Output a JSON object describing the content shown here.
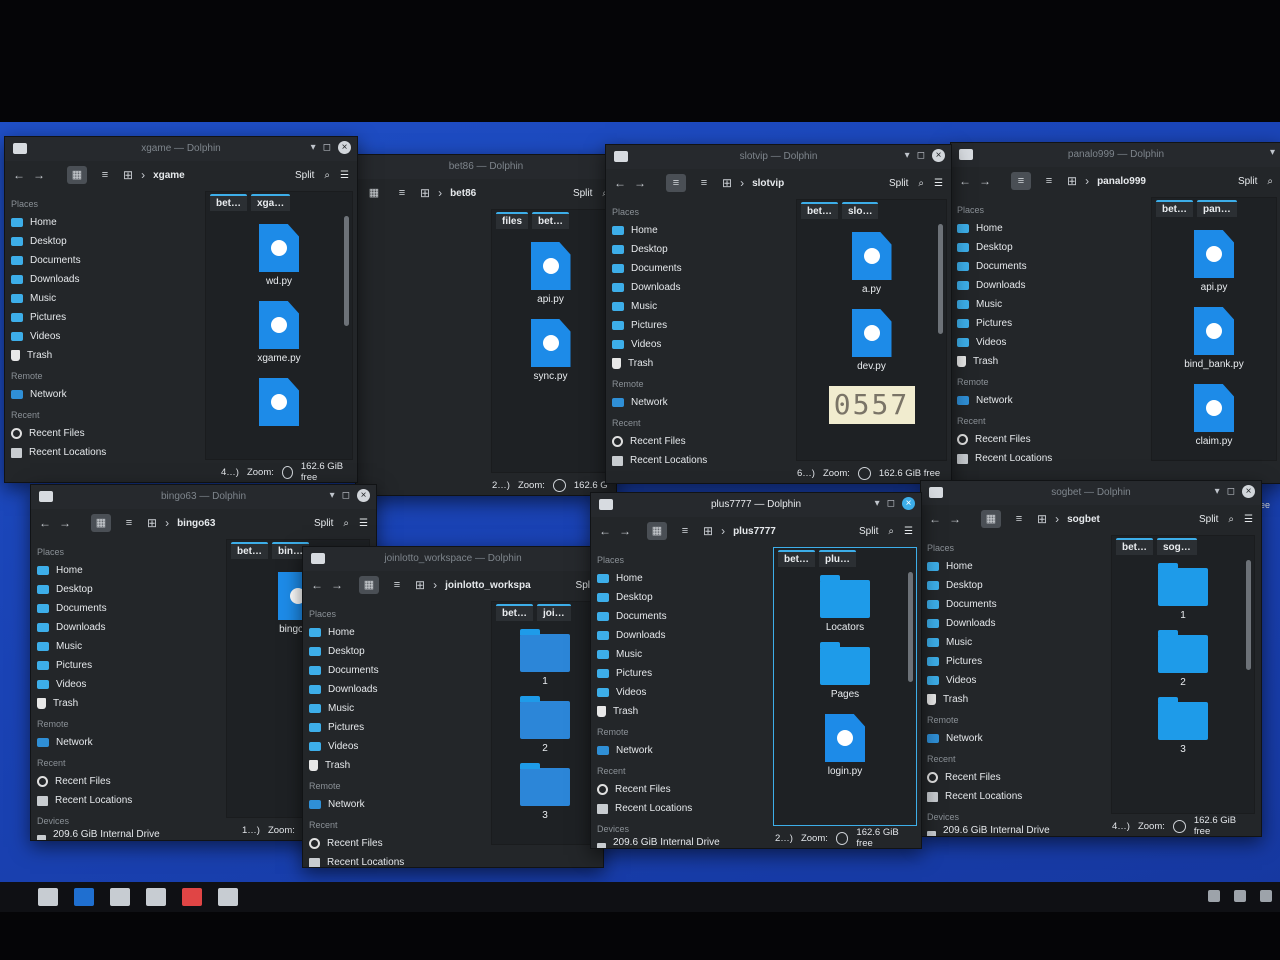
{
  "places": {
    "section_places": "Places",
    "home": "Home",
    "desktop": "Desktop",
    "documents": "Documents",
    "downloads": "Downloads",
    "music": "Music",
    "pictures": "Pictures",
    "videos": "Videos",
    "trash": "Trash",
    "section_remote": "Remote",
    "network": "Network",
    "section_recent": "Recent",
    "recent_files": "Recent Files",
    "recent_locations": "Recent Locations",
    "section_devices": "Devices",
    "drive": "209.6 GiB Internal Drive (nvme0n1…"
  },
  "common": {
    "split": "Split",
    "zoom": "Zoom:",
    "free": "162.6 GiB free"
  },
  "windows": {
    "w1": {
      "title": "xgame — Dolphin",
      "crumb": "xgame",
      "tab1": "bet…",
      "tab2": "xga…",
      "status_count": "4…)",
      "files": [
        "wd.py",
        "xgame.py"
      ]
    },
    "w2": {
      "title": "bet86 — Dolphin",
      "crumb": "bet86",
      "tab1": "files",
      "tab2": "bet…",
      "status_count": "2…)",
      "free_partial": "162.6 G",
      "files": [
        "api.py",
        "sync.py"
      ]
    },
    "w3": {
      "title": "slotvip — Dolphin",
      "crumb": "slotvip",
      "tab1": "bet…",
      "tab2": "slo…",
      "status_count": "6…)",
      "files": [
        "a.py",
        "dev.py"
      ],
      "captcha": "0557"
    },
    "w4": {
      "title": "panalo999 — Dolphin",
      "crumb": "panalo999",
      "tab1": "bet…",
      "tab2": "pan…",
      "files": [
        "api.py",
        "bind_bank.py",
        "claim.py"
      ]
    },
    "w5": {
      "title": "bingo63 — Dolphin",
      "crumb": "bingo63",
      "tab1": "bet…",
      "tab2": "bin…",
      "status_count": "1…)",
      "files": [
        "bingo.py"
      ]
    },
    "w6": {
      "title": "joinlotto_workspace — Dolphin",
      "crumb": "joinlotto_workspa",
      "tab1": "bet…",
      "tab2": "joi…",
      "files": [
        "1",
        "2",
        "3"
      ]
    },
    "w7": {
      "title": "plus7777 — Dolphin",
      "crumb": "plus7777",
      "tab1": "bet…",
      "tab2": "plu…",
      "status_count": "2…)",
      "files": [
        "Locators",
        "Pages",
        "login.py"
      ]
    },
    "w8": {
      "title": "sogbet — Dolphin",
      "crumb": "sogbet",
      "tab1": "bet…",
      "tab2": "sog…",
      "status_count": "4…)",
      "files": [
        "1",
        "2",
        "3"
      ]
    }
  },
  "edge_text": {
    "free": "free"
  }
}
